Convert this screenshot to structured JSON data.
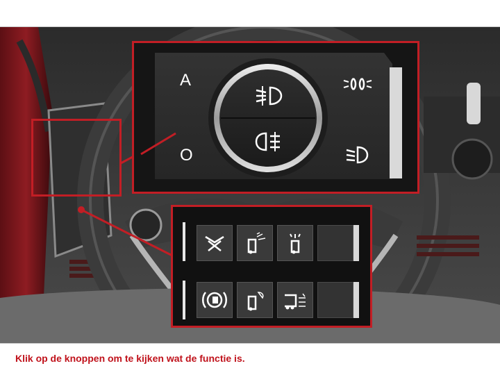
{
  "colors": {
    "accent": "#c21e25",
    "caption": "#c0121b",
    "panel": "#2b2b2b",
    "button": "#3a3a3a",
    "icon": "#ffffff"
  },
  "light_switch": {
    "auto_label": "A",
    "off_label": "O",
    "front_fog_icon": "front-fog-light-icon",
    "rear_fog_icon": "rear-fog-light-icon",
    "parking_icon": "parking-light-icon",
    "low_beam_icon": "low-beam-icon"
  },
  "button_panel": {
    "top_row": [
      {
        "icon": "hazard-cancel-icon"
      },
      {
        "icon": "cab-light-icon"
      },
      {
        "icon": "cab-roof-light-icon"
      },
      {
        "icon": "empty-slot"
      }
    ],
    "bottom_row": [
      {
        "icon": "parking-brake-icon"
      },
      {
        "icon": "work-light-icon"
      },
      {
        "icon": "trailer-work-light-icon"
      },
      {
        "icon": "empty-slot"
      }
    ]
  },
  "caption": "Klik op de knoppen om te kijken wat de functie is."
}
